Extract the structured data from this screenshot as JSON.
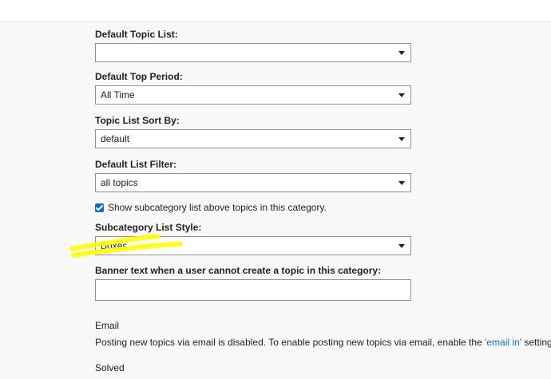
{
  "settings": {
    "default_topic_list": {
      "label": "Default Topic List:",
      "value": ""
    },
    "default_top_period": {
      "label": "Default Top Period:",
      "value": "All Time"
    },
    "topic_list_sort_by": {
      "label": "Topic List Sort By:",
      "value": "default"
    },
    "default_list_filter": {
      "label": "Default List Filter:",
      "value": "all topics"
    },
    "show_subcategory_list": {
      "label": "Show subcategory list above topics in this category.",
      "checked": true
    },
    "subcategory_list_style": {
      "label": "Subcategory List Style:",
      "value": "Boxes"
    },
    "banner_text": {
      "label": "Banner text when a user cannot create a topic in this category:",
      "value": ""
    }
  },
  "email": {
    "title": "Email",
    "text_before": "Posting new topics via email is disabled. To enable posting new topics via email, enable the ",
    "link_text": "'email in'",
    "text_after": " setting."
  },
  "solved": {
    "title": "Solved"
  },
  "colors": {
    "accent": "#0a6ed1",
    "highlight": "#ffff00",
    "border": "#919191",
    "background": "#f8f8f8"
  }
}
